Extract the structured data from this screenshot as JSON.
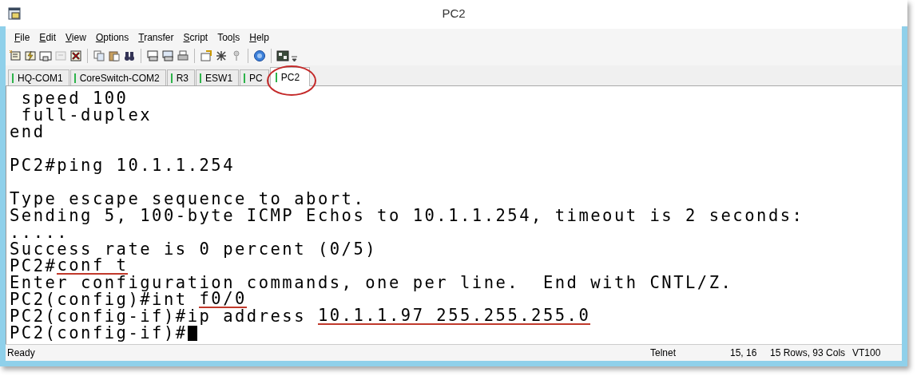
{
  "window": {
    "title": "PC2"
  },
  "menu": [
    {
      "key": "F",
      "post": "ile"
    },
    {
      "key": "E",
      "post": "dit"
    },
    {
      "key": "V",
      "post": "iew"
    },
    {
      "key": "O",
      "post": "ptions"
    },
    {
      "key": "T",
      "post": "ransfer"
    },
    {
      "key": "S",
      "post": "cript"
    },
    {
      "pre": "Too",
      "key": "l",
      "post": "s"
    },
    {
      "key": "H",
      "post": "elp"
    }
  ],
  "tabs": [
    {
      "label": "HQ-COM1",
      "selected": false,
      "circled": false
    },
    {
      "label": "CoreSwitch-COM2",
      "selected": false,
      "circled": false
    },
    {
      "label": "R3",
      "selected": false,
      "circled": false
    },
    {
      "label": "ESW1",
      "selected": false,
      "circled": false
    },
    {
      "label": "PC",
      "selected": false,
      "circled": false
    },
    {
      "label": "PC2",
      "selected": true,
      "circled": true
    }
  ],
  "terminal": {
    "lines": [
      {
        "segments": [
          {
            "text": " speed 100"
          }
        ]
      },
      {
        "segments": [
          {
            "text": " full-duplex"
          }
        ]
      },
      {
        "segments": [
          {
            "text": "end"
          }
        ]
      },
      {
        "gap_before": true,
        "segments": [
          {
            "text": "PC2#ping 10.1.1.254"
          }
        ]
      },
      {
        "gap_before": true,
        "segments": [
          {
            "text": "Type escape sequence to abort."
          }
        ]
      },
      {
        "segments": [
          {
            "text": "Sending 5, 100-byte ICMP Echos to 10.1.1.254, timeout is 2 seconds:"
          }
        ]
      },
      {
        "segments": [
          {
            "text": "....."
          }
        ]
      },
      {
        "segments": [
          {
            "text": "Success rate is 0 percent (0/5)"
          }
        ]
      },
      {
        "segments": [
          {
            "text": "PC2#"
          },
          {
            "text": "conf t",
            "underlined": true
          }
        ]
      },
      {
        "segments": [
          {
            "text": "Enter configuration commands, one per line.  End with CNTL/Z."
          }
        ]
      },
      {
        "segments": [
          {
            "text": "PC2(config)#int "
          },
          {
            "text": "f0/0",
            "underlined": true
          }
        ]
      },
      {
        "segments": [
          {
            "text": "PC2(config-if)#ip address "
          },
          {
            "text": "10.1.1.97 255.255.255.0",
            "underlined": true
          }
        ]
      },
      {
        "segments": [
          {
            "text": "PC2(config-if)#"
          }
        ],
        "cursor": true
      }
    ]
  },
  "status_bar": {
    "message": "Ready",
    "protocol": "Telnet",
    "position": "15, 16",
    "size": "15 Rows, 93 Cols",
    "emulation": "VT100"
  }
}
